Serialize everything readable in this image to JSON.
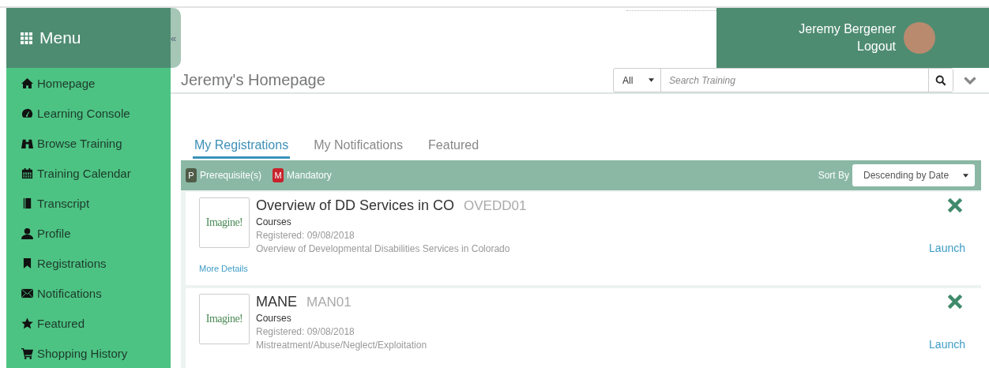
{
  "sidebar": {
    "title": "Menu",
    "collapse": "«",
    "items": [
      {
        "label": "Homepage"
      },
      {
        "label": "Learning Console"
      },
      {
        "label": "Browse Training"
      },
      {
        "label": "Training Calendar"
      },
      {
        "label": "Transcript"
      },
      {
        "label": "Profile"
      },
      {
        "label": "Registrations"
      },
      {
        "label": "Notifications"
      },
      {
        "label": "Featured"
      },
      {
        "label": "Shopping History"
      }
    ]
  },
  "user": {
    "name": "Jeremy Bergener",
    "logout": "Logout"
  },
  "page_title": "Jeremy's Homepage",
  "search": {
    "scope": "All",
    "placeholder": "Search Training"
  },
  "tabs": [
    {
      "label": "My Registrations",
      "selected": true
    },
    {
      "label": "My Notifications",
      "selected": false
    },
    {
      "label": "Featured",
      "selected": false
    }
  ],
  "legend": [
    {
      "letter": "P",
      "label": "Prerequisite(s)",
      "color": "#4f5d48"
    },
    {
      "letter": "M",
      "label": "Mandatory",
      "color": "#c8232c"
    }
  ],
  "sort": {
    "label": "Sort By",
    "value": "Descending by Date"
  },
  "registrations": [
    {
      "logo": "Imagine!",
      "title": "Overview of DD Services in CO",
      "code": "OVEDD01",
      "type": "Courses",
      "registered": "Registered: 09/08/2018",
      "description": "Overview of Developmental Disabilities Services in Colorado",
      "more_details": "More Details",
      "action": "Launch"
    },
    {
      "logo": "Imagine!",
      "title": "MANE",
      "code": "MAN01",
      "type": "Courses",
      "registered": "Registered: 09/08/2018",
      "description": "Mistreatment/Abuse/Neglect/Exploitation",
      "action": "Launch"
    }
  ]
}
